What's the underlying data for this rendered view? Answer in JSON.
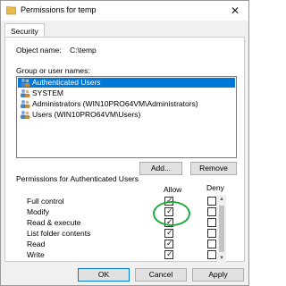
{
  "window": {
    "title": "Permissions for temp",
    "close_glyph": "✕"
  },
  "tabs": [
    {
      "label": "Security"
    }
  ],
  "object": {
    "label": "Object name:",
    "value": "C:\\temp"
  },
  "group": {
    "label": "Group or user names:",
    "users": [
      {
        "name": "Authenticated Users",
        "selected": true
      },
      {
        "name": "SYSTEM",
        "selected": false
      },
      {
        "name": "Administrators (WIN10PRO64VM\\Administrators)",
        "selected": false
      },
      {
        "name": "Users (WIN10PRO64VM\\Users)",
        "selected": false
      }
    ]
  },
  "buttons": {
    "add": "Add...",
    "remove": "Remove",
    "ok": "OK",
    "cancel": "Cancel",
    "apply": "Apply"
  },
  "permissions": {
    "title": "Permissions for Authenticated Users",
    "allow_header": "Allow",
    "deny_header": "Deny",
    "rows": [
      {
        "name": "Full control",
        "allow": false,
        "deny": false
      },
      {
        "name": "Modify",
        "allow": true,
        "deny": false
      },
      {
        "name": "Read & execute",
        "allow": true,
        "deny": false
      },
      {
        "name": "List folder contents",
        "allow": true,
        "deny": false
      },
      {
        "name": "Read",
        "allow": true,
        "deny": false
      },
      {
        "name": "Write",
        "allow": true,
        "deny": false
      }
    ]
  },
  "colors": {
    "selection": "#0078d7",
    "highlight_circle": "#1faa3c",
    "window_bg": "#f0f0f0"
  },
  "icons": {
    "title": "folder-shield-icon",
    "user": "users-group-icon"
  }
}
